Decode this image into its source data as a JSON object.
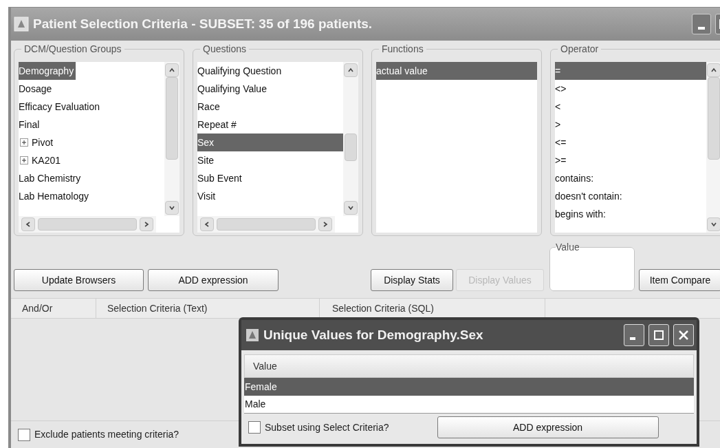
{
  "window": {
    "title": "Patient Selection Criteria - SUBSET: 35 of 196 patients."
  },
  "panels": [
    {
      "title": "DCM/Question Groups",
      "items": [
        {
          "label": "Demography",
          "selected": true,
          "kind": "leaf"
        },
        {
          "label": "Dosage",
          "selected": false,
          "kind": "leaf"
        },
        {
          "label": "Efficacy Evaluation",
          "selected": false,
          "kind": "leaf"
        },
        {
          "label": "Final",
          "selected": false,
          "kind": "leaf"
        },
        {
          "label": "Pivot",
          "selected": false,
          "kind": "branch",
          "expanded": false
        },
        {
          "label": "KA201",
          "selected": false,
          "kind": "branch",
          "expanded": false
        },
        {
          "label": "Lab Chemistry",
          "selected": false,
          "kind": "leaf"
        },
        {
          "label": "Lab Hematology",
          "selected": false,
          "kind": "leaf"
        }
      ]
    },
    {
      "title": "Questions",
      "items": [
        {
          "label": "Qualifying Question",
          "selected": false,
          "kind": "leaf"
        },
        {
          "label": "Qualifying Value",
          "selected": false,
          "kind": "leaf"
        },
        {
          "label": "Race",
          "selected": false,
          "kind": "leaf"
        },
        {
          "label": "Repeat #",
          "selected": false,
          "kind": "leaf"
        },
        {
          "label": "Sex",
          "selected": true,
          "kind": "leaf"
        },
        {
          "label": "Site",
          "selected": false,
          "kind": "leaf"
        },
        {
          "label": "Sub Event",
          "selected": false,
          "kind": "leaf"
        },
        {
          "label": "Visit",
          "selected": false,
          "kind": "leaf"
        }
      ]
    },
    {
      "title": "Functions",
      "items": [
        {
          "label": "actual value",
          "selected": true,
          "kind": "leaf"
        }
      ]
    },
    {
      "title": "Operator",
      "items": [
        {
          "label": "=",
          "selected": true,
          "kind": "leaf"
        },
        {
          "label": "<>",
          "selected": false,
          "kind": "leaf"
        },
        {
          "label": "<",
          "selected": false,
          "kind": "leaf"
        },
        {
          "label": ">",
          "selected": false,
          "kind": "leaf"
        },
        {
          "label": "<=",
          "selected": false,
          "kind": "leaf"
        },
        {
          "label": ">=",
          "selected": false,
          "kind": "leaf"
        },
        {
          "label": "contains:",
          "selected": false,
          "kind": "leaf"
        },
        {
          "label": "doesn't contain:",
          "selected": false,
          "kind": "leaf"
        },
        {
          "label": "begins with:",
          "selected": false,
          "kind": "leaf"
        }
      ]
    }
  ],
  "buttons_left": [
    {
      "label": "Update Browsers",
      "disabled": false
    },
    {
      "label": "ADD expression",
      "disabled": false
    }
  ],
  "buttons_mid": [
    {
      "label": "Display Stats",
      "disabled": false
    },
    {
      "label": "Display Values",
      "disabled": true
    }
  ],
  "value_box": {
    "title": "Value"
  },
  "compare_button": {
    "label": "Item Compare"
  },
  "table": {
    "columns": [
      "And/Or",
      "Selection Criteria (Text)",
      "Selection Criteria (SQL)"
    ]
  },
  "exclude_checkbox": {
    "label": "Exclude patients meeting criteria?",
    "checked": false
  },
  "dialog": {
    "title": "Unique Values for Demography.Sex",
    "column": "Value",
    "rows": [
      {
        "label": "Female",
        "selected": true
      },
      {
        "label": "Male",
        "selected": false
      }
    ],
    "checkbox": {
      "label": "Subset using Select Criteria?",
      "checked": false
    },
    "button": "ADD expression"
  }
}
